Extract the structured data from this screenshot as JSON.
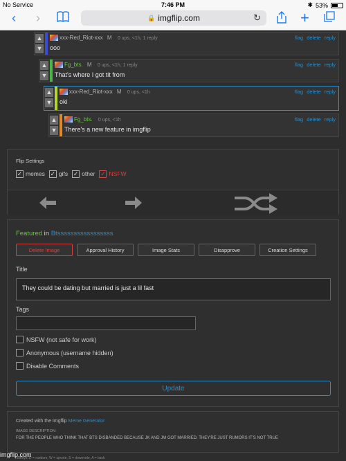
{
  "status": {
    "carrier": "No Service",
    "wifi_icon": "wifi-icon",
    "time": "7:46 PM",
    "battery": "53%"
  },
  "browser": {
    "url": "imgflip.com"
  },
  "comments": [
    {
      "user": "xxx-Red_Riot-xxx",
      "gender": "M",
      "stats": "0 ups, <1h, 1 reply",
      "text": "ooo",
      "bar_color": "#3b4bd4",
      "flag": "flag",
      "delete": "delete",
      "reply": "reply"
    },
    {
      "user": "Fg_bts.",
      "gender": "M",
      "stats": "0 ups, <1h, 1 reply",
      "text": "That's where I got tit from",
      "bar_color": "#4bb543",
      "flag": "flag",
      "delete": "delete",
      "reply": "reply"
    },
    {
      "user": "xxx-Red_Riot-xxx",
      "gender": "M",
      "stats": "0 ups, <1h",
      "text": "oki",
      "bar_color": "#b6d62a",
      "flag": "flag",
      "delete": "delete",
      "reply": "reply"
    },
    {
      "user": "Fg_bts.",
      "gender": "",
      "stats": "0 ups, <1h",
      "text": "There's a new feature in imgflip",
      "bar_color": "#e0892a",
      "flag": "flag",
      "delete": "delete",
      "reply": "reply"
    }
  ],
  "flip_settings": {
    "title": "Flip Settings",
    "options": [
      {
        "label": "memes",
        "checked": true
      },
      {
        "label": "gifs",
        "checked": true
      },
      {
        "label": "other",
        "checked": true
      },
      {
        "label": "NSFW",
        "checked": true
      }
    ]
  },
  "featured": {
    "featured_label": "Featured",
    "in_label": "in",
    "stream": "Btsssssssssssssssss",
    "buttons": {
      "delete": "Delete Image",
      "approval": "Approval History",
      "stats": "Image Stats",
      "disapprove": "Disapprove",
      "creation": "Creation Settings"
    },
    "title_label": "Title",
    "title_value": "They could be dating but married is just a lil fast",
    "tags_label": "Tags",
    "tags_value": "",
    "options": {
      "nsfw": "NSFW (not safe for work)",
      "anonymous": "Anonymous (username hidden)",
      "disable_comments": "Disable Comments"
    },
    "update": "Update"
  },
  "footer": {
    "created_prefix": "Created with the Imgflip",
    "created_link": "Meme Generator",
    "desc_label": "IMAGE DESCRIPTION:",
    "description": "FOR THE PEOPLE WHO THINK THAT BTS DISBANDED BECAUSE JK AND JM GOT MARRIED. THEY'RE JUST RUMORS IT'S NOT TRUE",
    "shortcuts": "hotkeys: D = random, W = upvote, S = downvote, A = back",
    "watermark": "imgflip.com"
  }
}
